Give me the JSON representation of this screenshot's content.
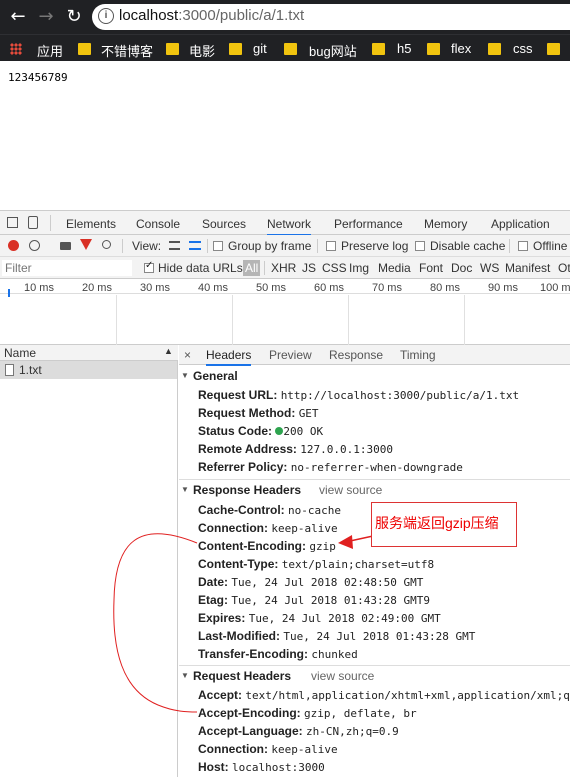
{
  "browser": {
    "url_host": "localhost",
    "url_rest": ":3000/public/a/1.txt",
    "bookmarks": [
      {
        "label": "应用",
        "type": "apps"
      },
      {
        "label": "不错博客",
        "type": "folder"
      },
      {
        "label": "电影",
        "type": "folder"
      },
      {
        "label": "git",
        "type": "folder"
      },
      {
        "label": "bug网站",
        "type": "folder"
      },
      {
        "label": "h5",
        "type": "folder"
      },
      {
        "label": "flex",
        "type": "folder"
      },
      {
        "label": "css",
        "type": "folder"
      }
    ]
  },
  "page": {
    "content": "123456789"
  },
  "devtools": {
    "tabs": [
      "Elements",
      "Console",
      "Sources",
      "Network",
      "Performance",
      "Memory",
      "Application"
    ],
    "active_tab": "Network",
    "toolbar": {
      "view_label": "View:",
      "group_by_frame": "Group by frame",
      "preserve_log": "Preserve log",
      "disable_cache": "Disable cache",
      "offline": "Offline"
    },
    "filterbar": {
      "filter_placeholder": "Filter",
      "hide_data_urls": "Hide data URLs",
      "types": [
        "All",
        "XHR",
        "JS",
        "CSS",
        "Img",
        "Media",
        "Font",
        "Doc",
        "WS",
        "Manifest",
        "Ot"
      ]
    },
    "timeline_ticks": [
      "10 ms",
      "20 ms",
      "30 ms",
      "40 ms",
      "50 ms",
      "60 ms",
      "70 ms",
      "80 ms",
      "90 ms",
      "100 m"
    ],
    "name_header": "Name",
    "files": [
      "1.txt"
    ],
    "detail_tabs": [
      "Headers",
      "Preview",
      "Response",
      "Timing"
    ],
    "close_glyph": "×",
    "general": {
      "title": "General",
      "rows": [
        {
          "k": "Request URL:",
          "v": "http://localhost:3000/public/a/1.txt"
        },
        {
          "k": "Request Method:",
          "v": "GET"
        },
        {
          "k": "Status Code:",
          "v": "200 OK"
        },
        {
          "k": "Remote Address:",
          "v": "127.0.0.1:3000"
        },
        {
          "k": "Referrer Policy:",
          "v": "no-referrer-when-downgrade"
        }
      ]
    },
    "response_headers": {
      "title": "Response Headers",
      "view_source": "view source",
      "rows": [
        {
          "k": "Cache-Control:",
          "v": "no-cache"
        },
        {
          "k": "Connection:",
          "v": "keep-alive"
        },
        {
          "k": "Content-Encoding:",
          "v": "gzip"
        },
        {
          "k": "Content-Type:",
          "v": "text/plain;charset=utf8"
        },
        {
          "k": "Date:",
          "v": "Tue, 24 Jul 2018 02:48:50 GMT"
        },
        {
          "k": "Etag:",
          "v": "Tue, 24 Jul 2018 01:43:28 GMT9"
        },
        {
          "k": "Expires:",
          "v": "Tue, 24 Jul 2018 02:49:00 GMT"
        },
        {
          "k": "Last-Modified:",
          "v": "Tue, 24 Jul 2018 01:43:28 GMT"
        },
        {
          "k": "Transfer-Encoding:",
          "v": "chunked"
        }
      ]
    },
    "request_headers": {
      "title": "Request Headers",
      "view_source": "view source",
      "rows": [
        {
          "k": "Accept:",
          "v": "text/html,application/xhtml+xml,application/xml;q"
        },
        {
          "k": "Accept-Encoding:",
          "v": "gzip, deflate, br"
        },
        {
          "k": "Accept-Language:",
          "v": "zh-CN,zh;q=0.9"
        },
        {
          "k": "Connection:",
          "v": "keep-alive"
        },
        {
          "k": "Host:",
          "v": "localhost:3000"
        }
      ]
    }
  },
  "annotation": {
    "text": "服务端返回gzip压缩",
    "color": "#e00"
  },
  "colors": {
    "status_ok": "#2ea44f",
    "accent": "#1a73e8",
    "record": "#d93025"
  }
}
